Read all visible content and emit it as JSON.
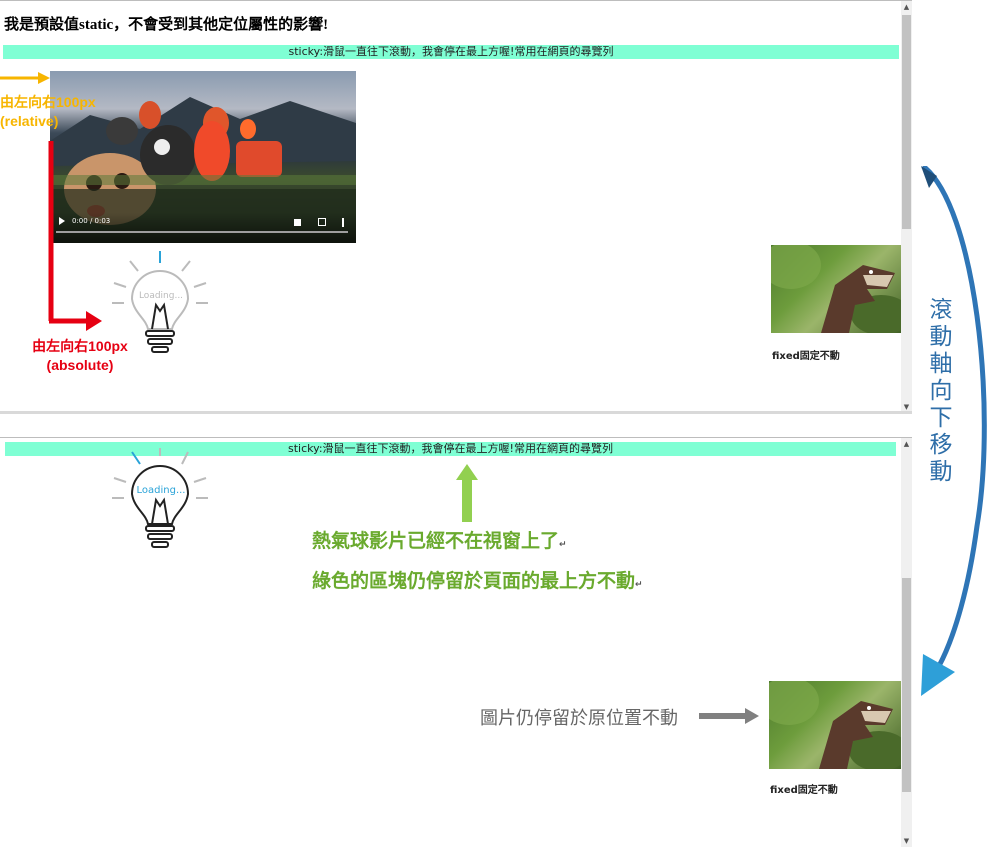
{
  "pane1": {
    "heading": "我是預設值static，不會受到其他定位屬性的影響!",
    "sticky_text": "sticky:滑鼠一直往下滾動，我會停在最上方喔!常用在網頁的尋覽列",
    "video_time": "0:00 / 0:03",
    "bulb_text": "Loading...",
    "fixed_caption": "fixed固定不動",
    "relative_label_line1": "由左向右100px",
    "relative_label_line2": "(relative)",
    "absolute_label_line1": "由左向右100px",
    "absolute_label_line2": "(absolute)"
  },
  "pane2": {
    "sticky_text": "sticky:滑鼠一直往下滾動，我會停在最上方喔!常用在網頁的尋覽列",
    "bulb_text": "Loading...",
    "note_line1": "熱氣球影片已經不在視窗上了",
    "note_line2": "綠色的區塊仍停留於頁面的最上方不動",
    "image_note": "圖片仍停留於原位置不動",
    "fixed_caption": "fixed固定不動"
  },
  "side_note": "滾動軸向下移動",
  "icons": [
    "play-icon",
    "volume-icon",
    "fullscreen-icon",
    "more-icon",
    "lightbulb-icon",
    "arrow-icon"
  ],
  "colors": {
    "sticky_bg": "#7fffd4",
    "orange": "#f7b500",
    "red": "#e60012",
    "green": "#6aaa2e",
    "blue": "#2e6ea8",
    "gray": "#666666"
  }
}
